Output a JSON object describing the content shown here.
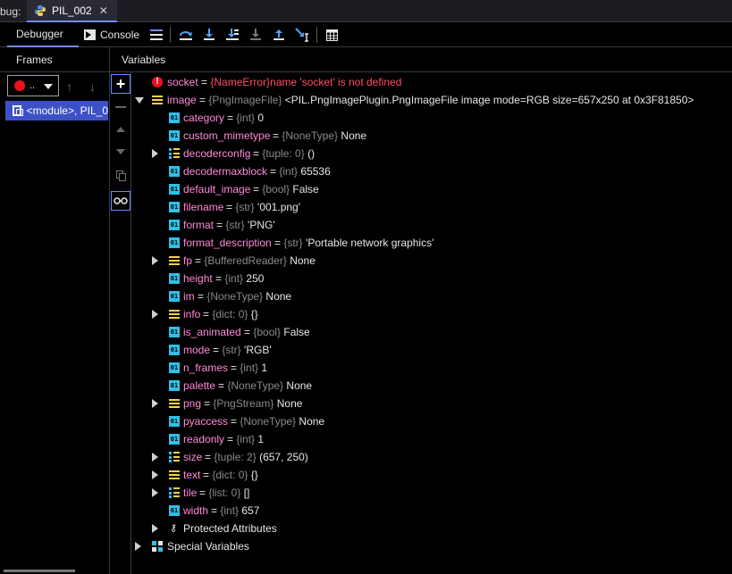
{
  "tabstrip": {
    "debug_prefix": "bug:",
    "run_tab_title": "PIL_002",
    "close_symbol": "✕"
  },
  "toolbar": {
    "debugger_tab": "Debugger",
    "console_tab": "Console",
    "buttons": [
      "show-execution-point-icon",
      "step-over-icon",
      "step-into-icon",
      "step-into-my-code-icon",
      "force-step-into-icon",
      "step-out-icon",
      "run-to-cursor-icon",
      "evaluate-expression-icon"
    ]
  },
  "panels": {
    "frames_title": "Frames",
    "variables_title": "Variables"
  },
  "frames": {
    "thread_label": "..",
    "frame_label": "<module>, PIL_0"
  },
  "variables": {
    "socket": {
      "name": "socket",
      "type": "{NameError}",
      "message": "name 'socket' is not defined"
    },
    "image": {
      "name": "image",
      "type": "{PngImageFile}",
      "value": "<PIL.PngImagePlugin.PngImageFile image mode=RGB size=657x250 at 0x3F81850>"
    },
    "children": [
      {
        "name": "category",
        "type": "{int}",
        "value": "0",
        "icon": "prim",
        "expandable": false
      },
      {
        "name": "custom_mimetype",
        "type": "{NoneType}",
        "value": "None",
        "icon": "prim",
        "expandable": false
      },
      {
        "name": "decoderconfig",
        "type": "{tuple: 0}",
        "value": "()",
        "icon": "list",
        "expandable": true
      },
      {
        "name": "decodermaxblock",
        "type": "{int}",
        "value": "65536",
        "icon": "prim",
        "expandable": false
      },
      {
        "name": "default_image",
        "type": "{bool}",
        "value": "False",
        "icon": "prim",
        "expandable": false
      },
      {
        "name": "filename",
        "type": "{str}",
        "value": "'001.png'",
        "icon": "prim",
        "expandable": false
      },
      {
        "name": "format",
        "type": "{str}",
        "value": "'PNG'",
        "icon": "prim",
        "expandable": false
      },
      {
        "name": "format_description",
        "type": "{str}",
        "value": "'Portable network graphics'",
        "icon": "prim",
        "expandable": false
      },
      {
        "name": "fp",
        "type": "{BufferedReader}",
        "value": "None",
        "icon": "obj",
        "expandable": true
      },
      {
        "name": "height",
        "type": "{int}",
        "value": "250",
        "icon": "prim",
        "expandable": false
      },
      {
        "name": "im",
        "type": "{NoneType}",
        "value": "None",
        "icon": "prim",
        "expandable": false
      },
      {
        "name": "info",
        "type": "{dict: 0}",
        "value": "{}",
        "icon": "obj",
        "expandable": true
      },
      {
        "name": "is_animated",
        "type": "{bool}",
        "value": "False",
        "icon": "prim",
        "expandable": false
      },
      {
        "name": "mode",
        "type": "{str}",
        "value": "'RGB'",
        "icon": "prim",
        "expandable": false
      },
      {
        "name": "n_frames",
        "type": "{int}",
        "value": "1",
        "icon": "prim",
        "expandable": false
      },
      {
        "name": "palette",
        "type": "{NoneType}",
        "value": "None",
        "icon": "prim",
        "expandable": false
      },
      {
        "name": "png",
        "type": "{PngStream}",
        "value": "None",
        "icon": "obj",
        "expandable": true
      },
      {
        "name": "pyaccess",
        "type": "{NoneType}",
        "value": "None",
        "icon": "prim",
        "expandable": false
      },
      {
        "name": "readonly",
        "type": "{int}",
        "value": "1",
        "icon": "prim",
        "expandable": false
      },
      {
        "name": "size",
        "type": "{tuple: 2}",
        "value": "(657, 250)",
        "icon": "list",
        "expandable": true
      },
      {
        "name": "text",
        "type": "{dict: 0}",
        "value": "{}",
        "icon": "obj",
        "expandable": true
      },
      {
        "name": "tile",
        "type": "{list: 0}",
        "value": "[]",
        "icon": "list",
        "expandable": true
      },
      {
        "name": "width",
        "type": "{int}",
        "value": "657",
        "icon": "prim",
        "expandable": false
      }
    ],
    "protected_attributes": "Protected Attributes",
    "special_variables": "Special Variables",
    "prim_icon_text": "01"
  },
  "colors": {
    "accent": "#6f8cff",
    "selection": "#3d51c7",
    "error": "#ff4d6a",
    "type_gray": "#8a8a8a",
    "primitive_icon": "#2fc0e8",
    "object_icon": "#ffd23f"
  }
}
